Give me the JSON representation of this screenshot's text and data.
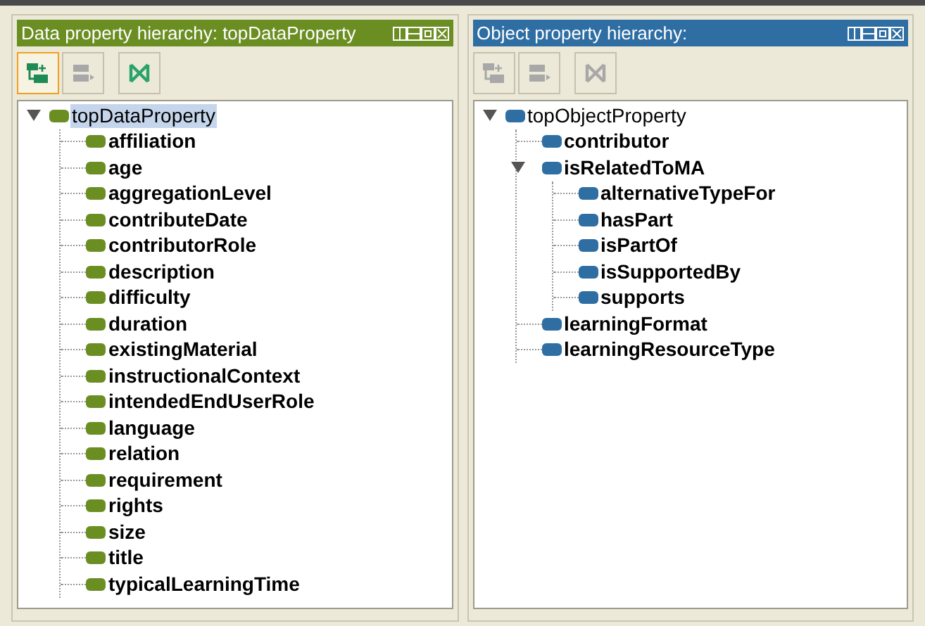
{
  "panels": [
    {
      "title": "Data property hierarchy: topDataProperty",
      "color": "#6b8e23",
      "toolbar": [
        {
          "kind": "add-sub",
          "disabled": false,
          "focused": true
        },
        {
          "kind": "add-sibling",
          "disabled": true,
          "focused": false
        },
        {
          "kind": "delete",
          "disabled": false,
          "focused": false
        }
      ],
      "tree": [
        {
          "label": "topDataProperty",
          "bold": false,
          "selected": true,
          "expanded": true,
          "children": [
            {
              "label": "affiliation",
              "bold": true,
              "selected": false
            },
            {
              "label": "age",
              "bold": true,
              "selected": false
            },
            {
              "label": "aggregationLevel",
              "bold": true,
              "selected": false
            },
            {
              "label": "contributeDate",
              "bold": true,
              "selected": false
            },
            {
              "label": "contributorRole",
              "bold": true,
              "selected": false
            },
            {
              "label": "description",
              "bold": true,
              "selected": false
            },
            {
              "label": "difficulty",
              "bold": true,
              "selected": false
            },
            {
              "label": "duration",
              "bold": true,
              "selected": false
            },
            {
              "label": "existingMaterial",
              "bold": true,
              "selected": false
            },
            {
              "label": "instructionalContext",
              "bold": true,
              "selected": false
            },
            {
              "label": "intendedEndUserRole",
              "bold": true,
              "selected": false
            },
            {
              "label": "language",
              "bold": true,
              "selected": false
            },
            {
              "label": "relation",
              "bold": true,
              "selected": false
            },
            {
              "label": "requirement",
              "bold": true,
              "selected": false
            },
            {
              "label": "rights",
              "bold": true,
              "selected": false
            },
            {
              "label": "size",
              "bold": true,
              "selected": false
            },
            {
              "label": "title",
              "bold": true,
              "selected": false
            },
            {
              "label": "typicalLearningTime",
              "bold": true,
              "selected": false
            }
          ]
        }
      ]
    },
    {
      "title": "Object property hierarchy:",
      "color": "#2f6ea3",
      "toolbar": [
        {
          "kind": "add-sub",
          "disabled": true,
          "focused": false
        },
        {
          "kind": "add-sibling",
          "disabled": true,
          "focused": false
        },
        {
          "kind": "delete",
          "disabled": true,
          "focused": false
        }
      ],
      "tree": [
        {
          "label": "topObjectProperty",
          "bold": false,
          "selected": false,
          "expanded": true,
          "children": [
            {
              "label": "contributor",
              "bold": true,
              "selected": false
            },
            {
              "label": "isRelatedToMA",
              "bold": true,
              "selected": false,
              "expanded": true,
              "children": [
                {
                  "label": "alternativeTypeFor",
                  "bold": true,
                  "selected": false
                },
                {
                  "label": "hasPart",
                  "bold": true,
                  "selected": false
                },
                {
                  "label": "isPartOf",
                  "bold": true,
                  "selected": false
                },
                {
                  "label": "isSupportedBy",
                  "bold": true,
                  "selected": false
                },
                {
                  "label": "supports",
                  "bold": true,
                  "selected": false
                }
              ]
            },
            {
              "label": "learningFormat",
              "bold": true,
              "selected": false
            },
            {
              "label": "learningResourceType",
              "bold": true,
              "selected": false
            }
          ]
        }
      ]
    }
  ]
}
